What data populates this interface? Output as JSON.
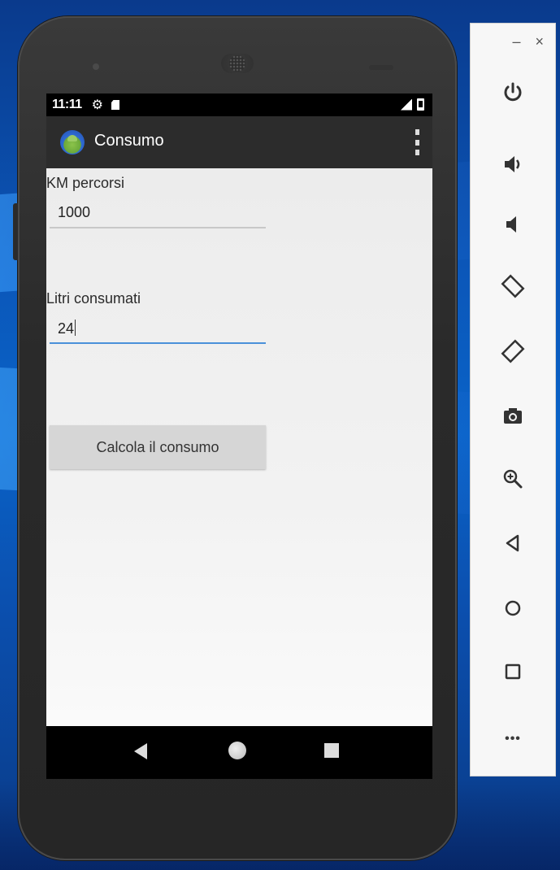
{
  "status_bar": {
    "time": "11:11",
    "settings_icon": "gear-icon",
    "sd_icon": "sd-card-icon",
    "signal_icon": "signal-icon",
    "battery_icon": "battery-icon"
  },
  "app_bar": {
    "title": "Consumo",
    "icon": "android-app-icon",
    "overflow_icon": "more-vertical-icon"
  },
  "form": {
    "km_label": "KM percorsi",
    "km_value": "1000",
    "liters_label": "Litri consumati",
    "liters_value": "24",
    "calc_button": "Calcola il consumo"
  },
  "nav_bar": {
    "back": "back-icon",
    "home": "home-icon",
    "recents": "recents-icon"
  },
  "emulator_toolbar": {
    "minimize": "–",
    "close": "×",
    "items": [
      "power-icon",
      "volume-up-icon",
      "volume-down-icon",
      "rotate-left-icon",
      "rotate-right-icon",
      "camera-icon",
      "zoom-icon",
      "back-icon",
      "home-icon",
      "overview-icon",
      "more-icon"
    ],
    "more_label": "•••"
  }
}
